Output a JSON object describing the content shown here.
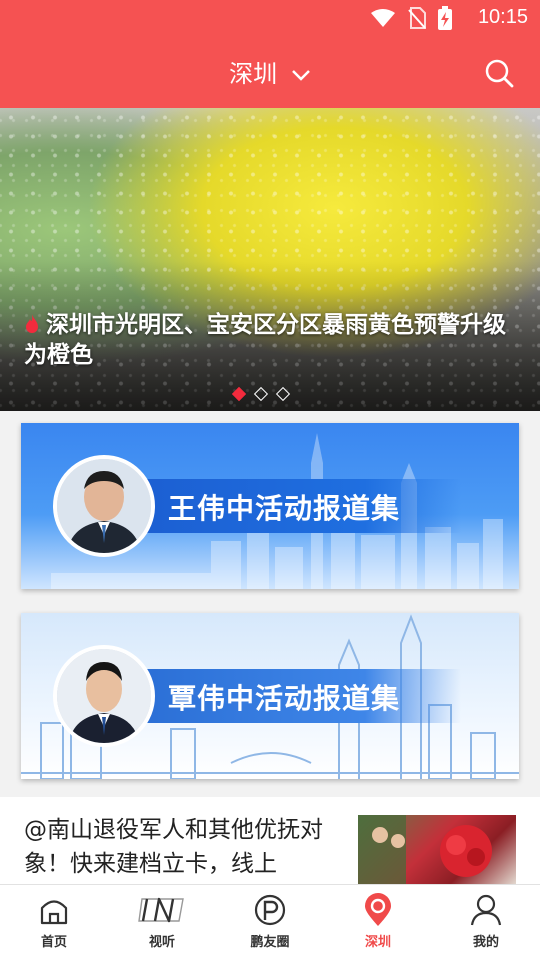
{
  "status_bar": {
    "time": "10:15",
    "icons": [
      "wifi-icon",
      "no-sim-icon",
      "battery-charging-icon"
    ]
  },
  "header": {
    "city": "深圳",
    "dropdown_icon": "chevron-down-icon",
    "search_icon": "search-icon"
  },
  "hero": {
    "caption": "深圳市光明区、宝安区分区暴雨黄色预警升级为橙色",
    "badge_icon": "fire-icon",
    "slide_count": 3,
    "active_slide": 1
  },
  "banners": [
    {
      "title": "王伟中活动报道集",
      "icon": "portrait"
    },
    {
      "title": "覃伟中活动报道集",
      "icon": "portrait"
    }
  ],
  "news": {
    "headline": "@南山退役军人和其他优抚对象！快来建档立卡，线上"
  },
  "tabbar": {
    "items": [
      {
        "label": "首页",
        "icon": "home-icon"
      },
      {
        "label": "视听",
        "icon": "in-icon"
      },
      {
        "label": "鹏友圈",
        "icon": "p-circle-icon"
      },
      {
        "label": "深圳",
        "icon": "location-pin-icon",
        "active": true
      },
      {
        "label": "我的",
        "icon": "user-icon"
      }
    ]
  },
  "colors": {
    "brand_red": "#f55252",
    "active_tab": "#f04a4a",
    "slide_active": "#f22b3d"
  }
}
